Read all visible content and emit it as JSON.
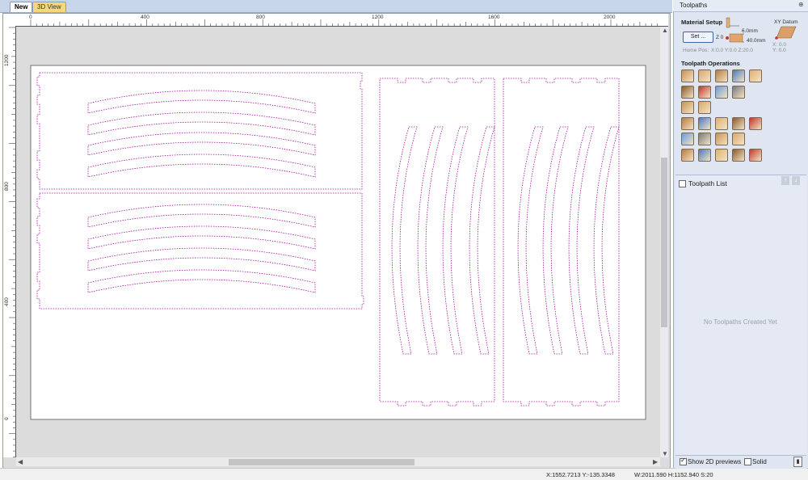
{
  "tabs": {
    "new": "New",
    "view3d": "3D View"
  },
  "ruler": {
    "h_labels": [
      "0",
      "400",
      "800",
      "1200",
      "1600",
      "2000"
    ],
    "v_labels": [
      "1200",
      "800",
      "400",
      "0"
    ]
  },
  "status": {
    "coords": "X:1552.7213 Y:-135.3348",
    "dims": "W:2011.590  H:1152.940  S:20"
  },
  "panel": {
    "title": "Toolpaths",
    "material_setup": {
      "heading": "Material Setup",
      "set_button": "Set ...",
      "home_pos_label": "Home Pos:",
      "home_pos_value": "X:0.0 Y:0.0 Z:20.0",
      "z_label": "Z 0",
      "thickness_top": "6.0mm",
      "thickness": "40.0mm",
      "xy_datum_label": "XY Datum",
      "datum_x": "X: 0.0",
      "datum_y": "Y: 0.0"
    },
    "operations_heading": "Toolpath Operations",
    "operation_icons": [
      [
        "profile-icon",
        "pocket-icon",
        "drill-icon",
        "vcarve-icon",
        "engrave-icon"
      ],
      [
        "fluting-icon",
        "prism-icon",
        "inlay-icon",
        "texture-icon"
      ],
      [
        "3d-rough-icon",
        "3d-finish-icon"
      ],
      [
        "template-icon",
        "edit-toolpath-icon",
        "copy-toolpath-icon",
        "delete-toolpath-icon",
        "calculator-icon"
      ],
      [
        "preview-selected-icon",
        "preview-all-icon",
        "reset-preview-icon",
        "merge-icon"
      ],
      [
        "tool-database-icon",
        "time-estimate-icon",
        "toolpath-summary-icon",
        "save-toolpath-icon",
        "export-icon"
      ]
    ],
    "toolpath_list": {
      "title": "Toolpath List",
      "empty_message": "No Toolpaths Created Yet"
    },
    "bottom": {
      "show_2d_previews": "Show 2D previews",
      "show_2d_checked": true,
      "solid": "Solid",
      "solid_checked": false
    }
  },
  "colors": {
    "vector_outline": "#a10e9c",
    "panel_bg": "#dfe6f2",
    "tab_3d": "#f6d77a"
  }
}
